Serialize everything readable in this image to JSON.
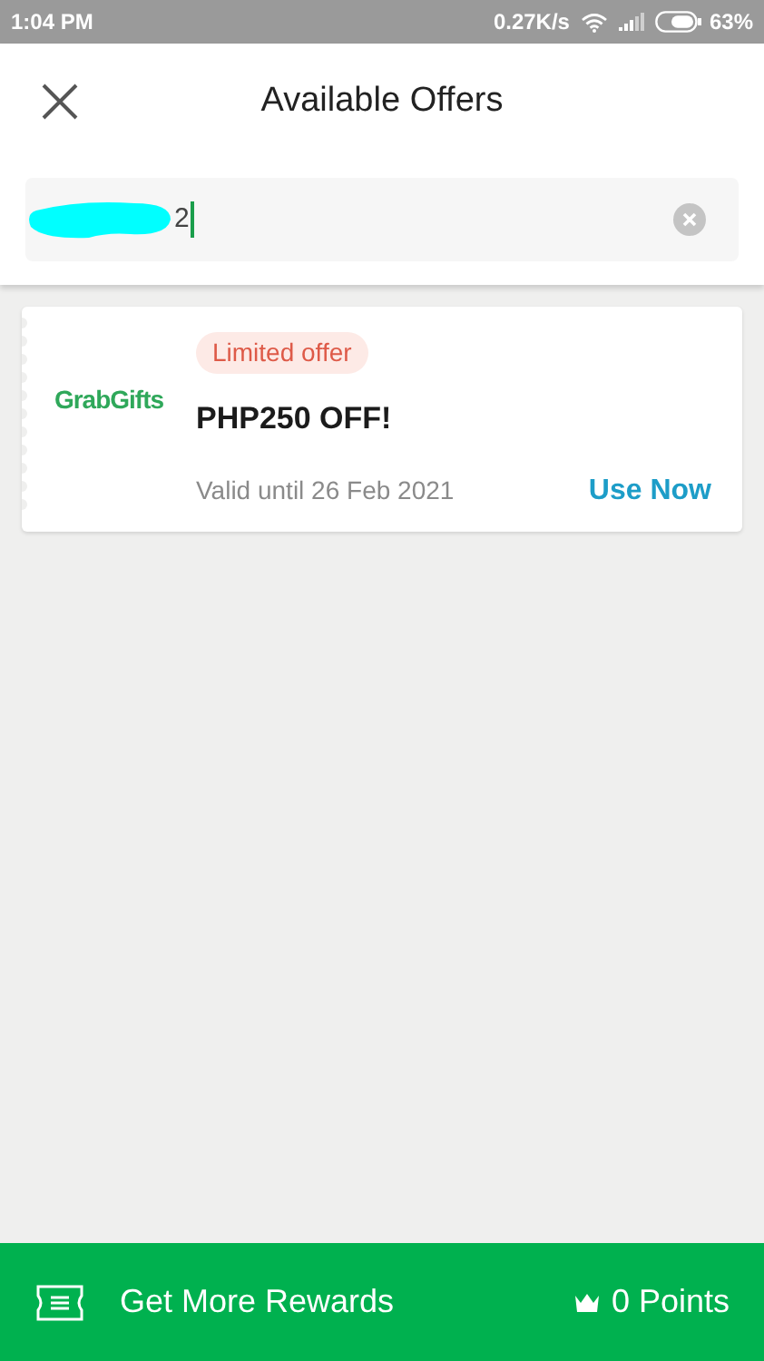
{
  "status_bar": {
    "time": "1:04 PM",
    "speed": "0.27K/s",
    "battery": "63%"
  },
  "header": {
    "title": "Available Offers"
  },
  "search": {
    "value": "2"
  },
  "offers": [
    {
      "brand": "GrabGifts",
      "badge": "Limited offer",
      "title": "PHP250 OFF!",
      "validity": "Valid until 26 Feb 2021",
      "action": "Use Now"
    }
  ],
  "bottom_bar": {
    "label": "Get More Rewards",
    "points": "0 Points"
  }
}
